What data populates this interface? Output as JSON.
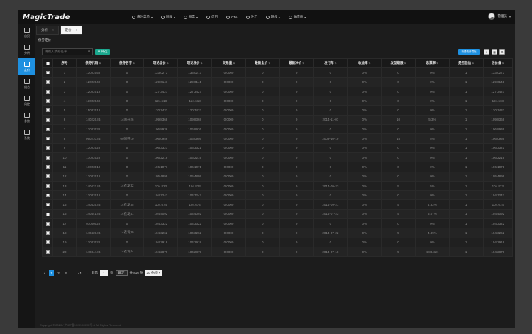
{
  "app": {
    "logo": "MagicTrade"
  },
  "topnav": [
    {
      "label": "临时菜单",
      "icon": "compass-icon",
      "caret": "▾"
    },
    {
      "label": "固收",
      "icon": "circle-icon",
      "caret": "▾"
    },
    {
      "label": "股票",
      "icon": "chart-icon",
      "caret": "▾"
    },
    {
      "label": "信用",
      "icon": "doc-icon",
      "caret": ""
    },
    {
      "label": "CTA",
      "icon": "cta-icon",
      "caret": ""
    },
    {
      "label": "外汇",
      "icon": "fx-icon",
      "caret": ""
    },
    {
      "label": "期权",
      "icon": "option-icon",
      "caret": "▾"
    },
    {
      "label": "做市商",
      "icon": "market-maker-icon",
      "caret": "▾"
    }
  ],
  "user": {
    "name": "管理员",
    "caret": "▾"
  },
  "sidebar": [
    {
      "label": "首页",
      "icon": "home-icon"
    },
    {
      "label": "分析",
      "icon": "analysis-icon"
    },
    {
      "label": "定价",
      "icon": "pricing-icon"
    },
    {
      "label": "组合",
      "icon": "portfolio-icon"
    },
    {
      "label": "风控",
      "icon": "shield-icon"
    },
    {
      "label": "参数",
      "icon": "params-icon"
    },
    {
      "label": "系统",
      "icon": "gear-icon"
    }
  ],
  "tabs": [
    {
      "label": "分析",
      "close": "×"
    },
    {
      "label": "定价",
      "close": "×"
    }
  ],
  "page": {
    "subtitle": "债券定价"
  },
  "search": {
    "placeholder": "请输入债券名字"
  },
  "filter_button": "筛选",
  "blue_button": "新建债券模板",
  "table": {
    "columns": [
      "序号",
      "债券代码",
      "债券名字",
      "理论全价",
      "理论净价",
      "交易量",
      "最新全价",
      "最新净价",
      "发行年",
      "收益率",
      "发型期限",
      "息票率",
      "是否低估",
      "估价值"
    ],
    "rows": [
      [
        "1",
        "1302205.I",
        "0",
        "133.0273",
        "133.0273",
        "0.0000",
        "0",
        "0",
        "0",
        "0%",
        "0",
        "0%",
        "1",
        "133.0273"
      ],
      [
        "2",
        "1202204.I",
        "0",
        "129.0141",
        "129.0141",
        "0.0000",
        "0",
        "0",
        "0",
        "0%",
        "0",
        "0%",
        "1",
        "129.0141"
      ],
      [
        "3",
        "1202201.I",
        "0",
        "127.3427",
        "127.3427",
        "0.0000",
        "0",
        "0",
        "0",
        "0%",
        "0",
        "0%",
        "1",
        "127.3427"
      ],
      [
        "4",
        "1302204.I",
        "0",
        "124.618",
        "124.618",
        "0.0000",
        "0",
        "0",
        "0",
        "0%",
        "0",
        "0%",
        "1",
        "124.618"
      ],
      [
        "5",
        "1502201.I",
        "0",
        "120.7433",
        "120.7433",
        "0.0000",
        "0",
        "0",
        "0",
        "0%",
        "0",
        "0%",
        "1",
        "120.7433"
      ],
      [
        "6",
        "140226.IB",
        "14国开26",
        "109.8368",
        "109.8368",
        "0.0000",
        "0",
        "0",
        "2014-11-07",
        "0%",
        "10",
        "5.3%",
        "1",
        "109.8368"
      ],
      [
        "7",
        "1702303.I",
        "0",
        "106.8936",
        "106.8936",
        "0.0000",
        "0",
        "0",
        "0",
        "0%",
        "0",
        "0%",
        "1",
        "106.8936"
      ],
      [
        "8",
        "090210.IB",
        "09国开10",
        "106.0956",
        "106.0956",
        "0.0000",
        "0",
        "0",
        "2009-10-19",
        "0%",
        "15",
        "5%",
        "1",
        "106.0956"
      ],
      [
        "9",
        "1302202.I",
        "0",
        "106.3321",
        "106.3321",
        "0.0000",
        "0",
        "0",
        "0",
        "0%",
        "0",
        "0%",
        "1",
        "106.3321"
      ],
      [
        "10",
        "1702202.I",
        "0",
        "106.2219",
        "106.2219",
        "0.0000",
        "0",
        "0",
        "0",
        "0%",
        "0",
        "0%",
        "1",
        "106.2219"
      ],
      [
        "11",
        "1702301.I",
        "0",
        "106.1071",
        "106.1071",
        "0.0000",
        "0",
        "0",
        "0",
        "0%",
        "0",
        "0%",
        "1",
        "106.1071"
      ],
      [
        "12",
        "1302201.I",
        "0",
        "105.4899",
        "105.4899",
        "0.0000",
        "0",
        "0",
        "0",
        "0%",
        "0",
        "0%",
        "1",
        "105.4899"
      ],
      [
        "13",
        "140432.IB",
        "14农发32",
        "104.823",
        "104.823",
        "0.0000",
        "0",
        "0",
        "2014-09-23",
        "0%",
        "5",
        "5%",
        "1",
        "104.823"
      ],
      [
        "14",
        "1702201.I",
        "0",
        "104.7247",
        "104.7247",
        "0.0000",
        "0",
        "0",
        "0",
        "0%",
        "0",
        "0%",
        "1",
        "104.7247"
      ],
      [
        "15",
        "140435.IB",
        "14农发35",
        "104.674",
        "104.674",
        "0.0000",
        "0",
        "0",
        "2014-09-21",
        "0%",
        "5",
        "4.82%",
        "1",
        "104.674"
      ],
      [
        "16",
        "140441.IB",
        "14农发41",
        "104.4092",
        "104.4092",
        "0.0000",
        "0",
        "0",
        "2014-07-23",
        "0%",
        "5",
        "5.07%",
        "1",
        "104.4092"
      ],
      [
        "17",
        "0700002.I",
        "0",
        "104.3322",
        "104.3322",
        "0.0000",
        "0",
        "0",
        "0",
        "0%",
        "0",
        "0%",
        "1",
        "104.3322"
      ],
      [
        "18",
        "140439.IB",
        "14农发39",
        "104.3262",
        "104.3262",
        "0.0000",
        "0",
        "0",
        "2014-07-22",
        "0%",
        "5",
        "4.89%",
        "1",
        "104.3262"
      ],
      [
        "19",
        "1702302.I",
        "0",
        "104.2918",
        "104.2918",
        "0.0000",
        "0",
        "0",
        "0",
        "0%",
        "0",
        "0%",
        "1",
        "104.2918"
      ],
      [
        "20",
        "140344.IB",
        "14农发44",
        "104.2879",
        "104.2879",
        "0.0000",
        "0",
        "0",
        "2014-07-18",
        "0%",
        "5",
        "4.8841%",
        "1",
        "104.2879"
      ]
    ]
  },
  "pager": {
    "prev": "‹",
    "pages": [
      "1",
      "2",
      "3"
    ],
    "ellipsis": "...",
    "last": "41",
    "next": "›",
    "goto_label": "到第",
    "page_value": "1",
    "page_suffix": "页",
    "go_label": "确定",
    "total": "共 816 条",
    "page_size": "20 条/页",
    "size_caret": "▾"
  },
  "footer": {
    "copyright": "Copyright © 2020 / 沪ICP备XXXXXXXX号-1 All Rights Reserved"
  },
  "colors": {
    "accent": "#1e90e0",
    "filter": "#1aa88e"
  }
}
